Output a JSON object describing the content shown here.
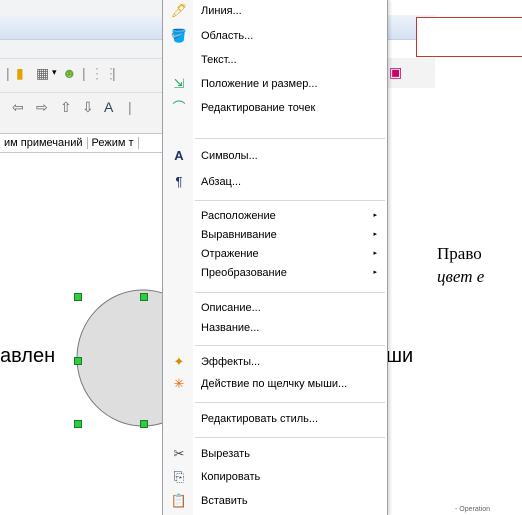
{
  "status_tabs": [
    "им примечаний",
    "Режим т"
  ],
  "document": {
    "line1": "Право",
    "line2": "цвет е",
    "shape_text_left": "авлен",
    "shape_text_right": "ши",
    "bottom_crop": "- Operation"
  },
  "menu": {
    "items": [
      {
        "label": "Линия...",
        "icon": "line-icon",
        "glyph": "🖊"
      },
      {
        "label": "Область...",
        "icon": "area-fill-icon",
        "glyph": "🪣"
      },
      {
        "label": "Текст...",
        "icon": "",
        "glyph": ""
      },
      {
        "label": "Положение и размер...",
        "icon": "position-size-icon",
        "glyph": "⇲"
      },
      {
        "label": "Редактирование точек",
        "icon": "edit-points-icon",
        "glyph": "⌒"
      },
      {
        "label": "Символы...",
        "icon": "characters-icon",
        "glyph": "A"
      },
      {
        "label": "Абзац...",
        "icon": "paragraph-icon",
        "glyph": "¶"
      },
      {
        "label": "Расположение",
        "icon": "",
        "glyph": "",
        "submenu": true
      },
      {
        "label": "Выравнивание",
        "icon": "",
        "glyph": "",
        "submenu": true
      },
      {
        "label": "Отражение",
        "icon": "",
        "glyph": "",
        "submenu": true
      },
      {
        "label": "Преобразование",
        "icon": "",
        "glyph": "",
        "submenu": true
      },
      {
        "label": "Описание...",
        "icon": "",
        "glyph": ""
      },
      {
        "label": "Название...",
        "icon": "",
        "glyph": ""
      },
      {
        "label": "Эффекты...",
        "icon": "effects-icon",
        "glyph": "✦"
      },
      {
        "label": "Действие по щелчку мыши...",
        "icon": "mouse-click-icon",
        "glyph": "✳"
      },
      {
        "label": "Редактировать стиль...",
        "icon": "",
        "glyph": ""
      },
      {
        "label": "Вырезать",
        "icon": "scissors-icon",
        "glyph": "✂"
      },
      {
        "label": "Копировать",
        "icon": "copy-icon",
        "glyph": "⎘"
      },
      {
        "label": "Вставить",
        "icon": "paste-icon",
        "glyph": "📋"
      }
    ],
    "submenu_arrow": "▸"
  }
}
